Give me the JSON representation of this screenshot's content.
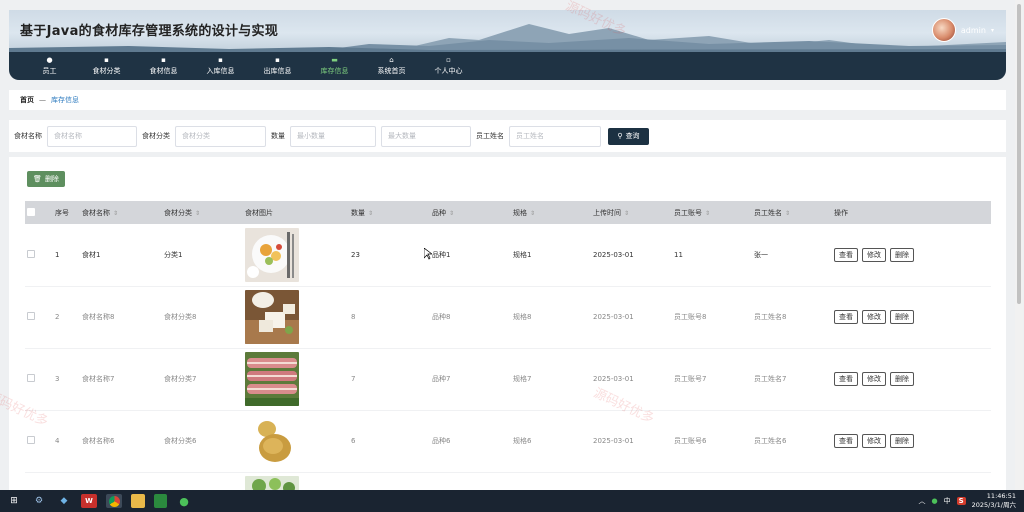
{
  "app": {
    "title": "基于Java的食材库存管理系统的设计与实现",
    "user": "admin"
  },
  "nav": [
    {
      "label": "员工",
      "icon": "●"
    },
    {
      "label": "食材分类",
      "icon": "▪"
    },
    {
      "label": "食材信息",
      "icon": "▪"
    },
    {
      "label": "入库信息",
      "icon": "▪"
    },
    {
      "label": "出库信息",
      "icon": "▪"
    },
    {
      "label": "库存信息",
      "icon": "▬"
    },
    {
      "label": "系统首页",
      "icon": "⌂"
    },
    {
      "label": "个人中心",
      "icon": "▫"
    }
  ],
  "breadcrumb": {
    "home": "首页",
    "sep": "—",
    "current": "库存信息"
  },
  "search": {
    "name_label": "食材名称",
    "name_placeholder": "食材名称",
    "category_label": "食材分类",
    "category_placeholder": "食材分类",
    "qty_label": "数量",
    "qty_min_placeholder": "最小数量",
    "qty_max_placeholder": "最大数量",
    "employee_label": "员工姓名",
    "employee_placeholder": "员工姓名",
    "query_button": "查询"
  },
  "toolbar": {
    "delete_label": "删除"
  },
  "table": {
    "headers": {
      "index": "序号",
      "name": "食材名称",
      "category": "食材分类",
      "image": "食材图片",
      "qty": "数量",
      "variety": "品种",
      "spec": "规格",
      "upload_time": "上传时间",
      "emp_account": "员工账号",
      "emp_name": "员工姓名",
      "actions": "操作"
    },
    "op_labels": {
      "view": "查看",
      "edit": "修改",
      "delete": "删除"
    },
    "rows": [
      {
        "index": "1",
        "name": "食材1",
        "category": "分类1",
        "image": "plate",
        "qty": "23",
        "variety": "品种1",
        "spec": "规格1",
        "upload_time": "2025-03-01",
        "emp_account": "11",
        "emp_name": "张一"
      },
      {
        "index": "2",
        "name": "食材名称8",
        "category": "食材分类8",
        "image": "tofu",
        "qty": "8",
        "variety": "品种8",
        "spec": "规格8",
        "upload_time": "2025-03-01",
        "emp_account": "员工账号8",
        "emp_name": "员工姓名8"
      },
      {
        "index": "3",
        "name": "食材名称7",
        "category": "食材分类7",
        "image": "meat",
        "qty": "7",
        "variety": "品种7",
        "spec": "规格7",
        "upload_time": "2025-03-01",
        "emp_account": "员工账号7",
        "emp_name": "员工姓名7"
      },
      {
        "index": "4",
        "name": "食材名称6",
        "category": "食材分类6",
        "image": "potato",
        "qty": "6",
        "variety": "品种6",
        "spec": "规格6",
        "upload_time": "2025-03-01",
        "emp_account": "员工账号6",
        "emp_name": "员工姓名6"
      }
    ]
  },
  "watermark": "源码好优多",
  "taskbar": {
    "time": "11:46:51",
    "date": "2025/3/1/周六",
    "ime": "中"
  }
}
